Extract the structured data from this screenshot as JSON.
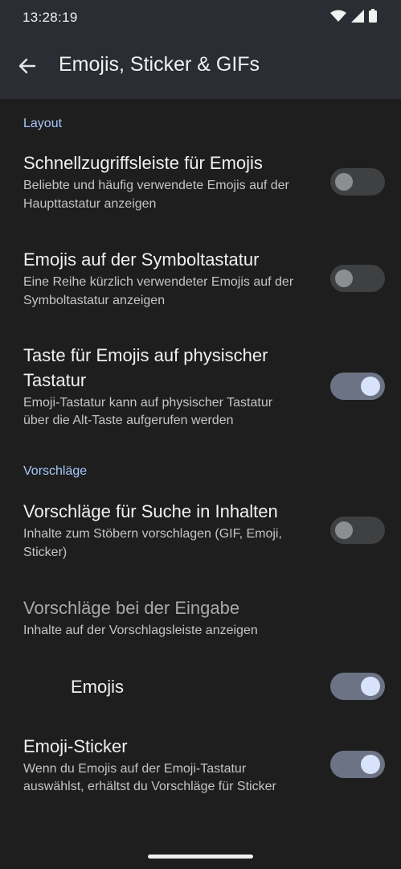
{
  "status_bar": {
    "time": "13:28:19",
    "icons": [
      "wifi-icon",
      "cell-signal-icon",
      "battery-icon"
    ]
  },
  "app_bar": {
    "title": "Emojis, Sticker & GIFs",
    "back_icon": "arrow-left-icon"
  },
  "sections": {
    "layout": {
      "label": "Layout",
      "items": [
        {
          "title": "Schnellzugriffsleiste für Emojis",
          "subtitle_l1": "Beliebte und häufig verwendete Emojis auf der",
          "subtitle_l2": "Haupttastatur anzeigen",
          "enabled": false
        },
        {
          "title": "Emojis auf der Symboltastatur",
          "subtitle_l1": "Eine Reihe kürzlich verwendeter Emojis auf der",
          "subtitle_l2": "Symboltastatur anzeigen",
          "enabled": false
        },
        {
          "title_l1": "Taste für Emojis auf physischer",
          "title_l2": "Tastatur",
          "subtitle_l1": "Emoji-Tastatur kann auf physischer Tastatur",
          "subtitle_l2": "über die Alt-Taste aufgerufen werden",
          "enabled": true
        }
      ]
    },
    "suggestions": {
      "label": "Vorschläge",
      "items": [
        {
          "title": "Vorschläge für Suche in Inhalten",
          "subtitle_l1": "Inhalte zum Stöbern vorschlagen (GIF, Emoji,",
          "subtitle_l2": "Sticker)",
          "enabled": false
        },
        {
          "title": "Vorschläge bei der Eingabe",
          "subtitle": "Inhalte auf der Vorschlagsleiste anzeigen"
        },
        {
          "title": "Emojis",
          "enabled": true
        },
        {
          "title": "Emoji-Sticker",
          "subtitle_l1": "Wenn du Emojis auf der Emoji-Tastatur",
          "subtitle_l2": "auswählst, erhältst du Vorschläge für Sticker",
          "enabled": true
        }
      ]
    }
  },
  "colors": {
    "accent": "#a8c7fa",
    "background": "#1e1e1e",
    "toolbar": "#2a2d33"
  }
}
